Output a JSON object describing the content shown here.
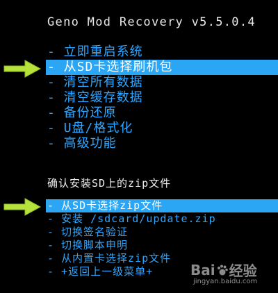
{
  "header": {
    "title": "Geno Mod Recovery v5.5.0.4"
  },
  "main_menu": {
    "items": [
      {
        "label": "- 立即重启系统"
      },
      {
        "label": "- 从SD卡选择刷机包"
      },
      {
        "label": "- 清空所有数据"
      },
      {
        "label": "- 清空缓存数据"
      },
      {
        "label": "- 备份还原"
      },
      {
        "label": "- U盘/格式化"
      },
      {
        "label": "- 高级功能"
      }
    ],
    "selected_index": 1
  },
  "sub_section": {
    "heading": "确认安装SD上的zip文件",
    "items": [
      {
        "label": "- 从SD卡选择zip文件"
      },
      {
        "label": "- 安装 /sdcard/update.zip"
      },
      {
        "label": "- 切换签名验证"
      },
      {
        "label": "- 切换脚本申明"
      },
      {
        "label": "- 从内置卡选择zip文件"
      },
      {
        "label": "- +返回上一级菜单+"
      }
    ],
    "selected_index": 0
  },
  "watermark": {
    "brand_left": "Bai",
    "brand_right": "经验",
    "url": "jingyan.baidu.com"
  },
  "colors": {
    "background": "#000000",
    "highlight": "#2aa6f5",
    "menu_text": "#2ea6ff",
    "arrow": "#b7e23c"
  }
}
